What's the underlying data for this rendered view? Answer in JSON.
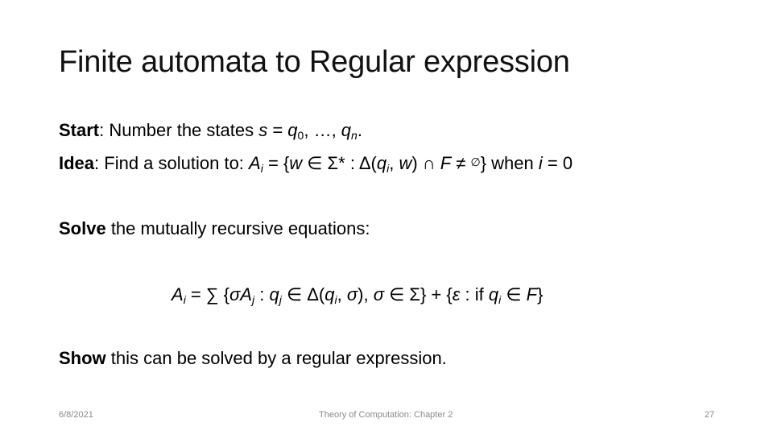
{
  "slide": {
    "title": "Finite automata to Regular expression",
    "start": {
      "label": "Start",
      "text_before": ": Number the states ",
      "s": "s",
      "eq": " = ",
      "q": "q",
      "sub0": "0",
      "sep": ", …, ",
      "q2": "q",
      "subn": "n",
      "end": "."
    },
    "idea": {
      "label": "Idea",
      "text_before": ":  Find a solution to:  ",
      "A": "A",
      "sub_i": "i",
      "part1": " = {",
      "w": "w",
      "part2": " ∈ Σ* :  Δ(",
      "q": "q",
      "sub_i2": "i",
      "part3": ", ",
      "w2": "w",
      "part4": ") ∩ ",
      "F": "F",
      "part5": " ≠ ",
      "empty": "∅",
      "part6": "}   when ",
      "i": "i",
      "part7": " = 0"
    },
    "solve": {
      "label": "Solve",
      "text": " the mutually recursive equations:"
    },
    "equation": {
      "A": "A",
      "sub_i": "i",
      "p1": " = ∑ {",
      "sigmaA": "σA",
      "sub_j": "j",
      "p2": " : ",
      "q": "q",
      "sub_j2": "j",
      "p3": " ∈ Δ(",
      "q2": "q",
      "sub_i2": "i",
      "p4": ", ",
      "sigma": "σ",
      "p5": "), ",
      "sigma2": "σ",
      "p6": " ∈ Σ} + {",
      "eps": "ε",
      "p7": " : if ",
      "q3": "q",
      "sub_i3": "i",
      "p8": " ∈ ",
      "F": "F",
      "p9": "}"
    },
    "show": {
      "label": "Show",
      "text": " this can be solved by a regular expression."
    },
    "footer": {
      "date": "6/8/2021",
      "center": "Theory of Computation: Chapter 2",
      "page": "27"
    }
  }
}
